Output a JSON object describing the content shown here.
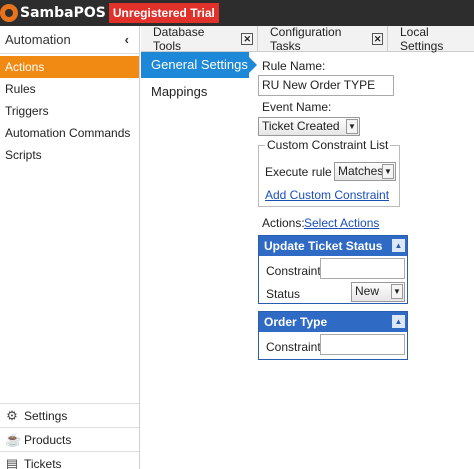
{
  "titlebar": {
    "app_name": "SambaPOS",
    "badge": "Unregistered Trial"
  },
  "sidebar": {
    "header": "Automation",
    "collapse_glyph": "‹",
    "items": [
      {
        "label": "Actions",
        "active": true
      },
      {
        "label": "Rules"
      },
      {
        "label": "Triggers"
      },
      {
        "label": "Automation Commands"
      },
      {
        "label": "Scripts"
      }
    ],
    "bottom": [
      {
        "label": "Settings",
        "icon": "gear-icon"
      },
      {
        "label": "Products",
        "icon": "cup-icon"
      },
      {
        "label": "Tickets",
        "icon": "ticket-icon"
      }
    ]
  },
  "tabs": [
    {
      "label": "Database Tools",
      "closable": true
    },
    {
      "label": "Configuration Tasks",
      "closable": true
    },
    {
      "label": "Local Settings",
      "closable": false
    }
  ],
  "subnav": [
    {
      "label": "General Settings",
      "active": true
    },
    {
      "label": "Mappings"
    }
  ],
  "form": {
    "rule_name_label": "Rule Name:",
    "rule_name_value": "RU New Order TYPE",
    "event_name_label": "Event Name:",
    "event_name_value": "Ticket Created",
    "constraint_group_title": "Custom Constraint List",
    "execute_rule_label": "Execute rule if",
    "execute_rule_value": "Matches",
    "add_constraint_link": "Add Custom Constraint",
    "actions_label": "Actions:",
    "select_actions_link": "Select Actions"
  },
  "action_panels": [
    {
      "title": "Update Ticket Status",
      "constraint_label": "Constraint:",
      "constraint_value": "",
      "status_label": "Status",
      "status_value": "New"
    },
    {
      "title": "Order Type",
      "constraint_label": "Constraint:",
      "constraint_value": ""
    }
  ],
  "colors": {
    "active_sidebar": "#f08a13",
    "active_subnav": "#1e88d8",
    "panel_header": "#2f6ac4",
    "trial_badge": "#e0312b"
  }
}
